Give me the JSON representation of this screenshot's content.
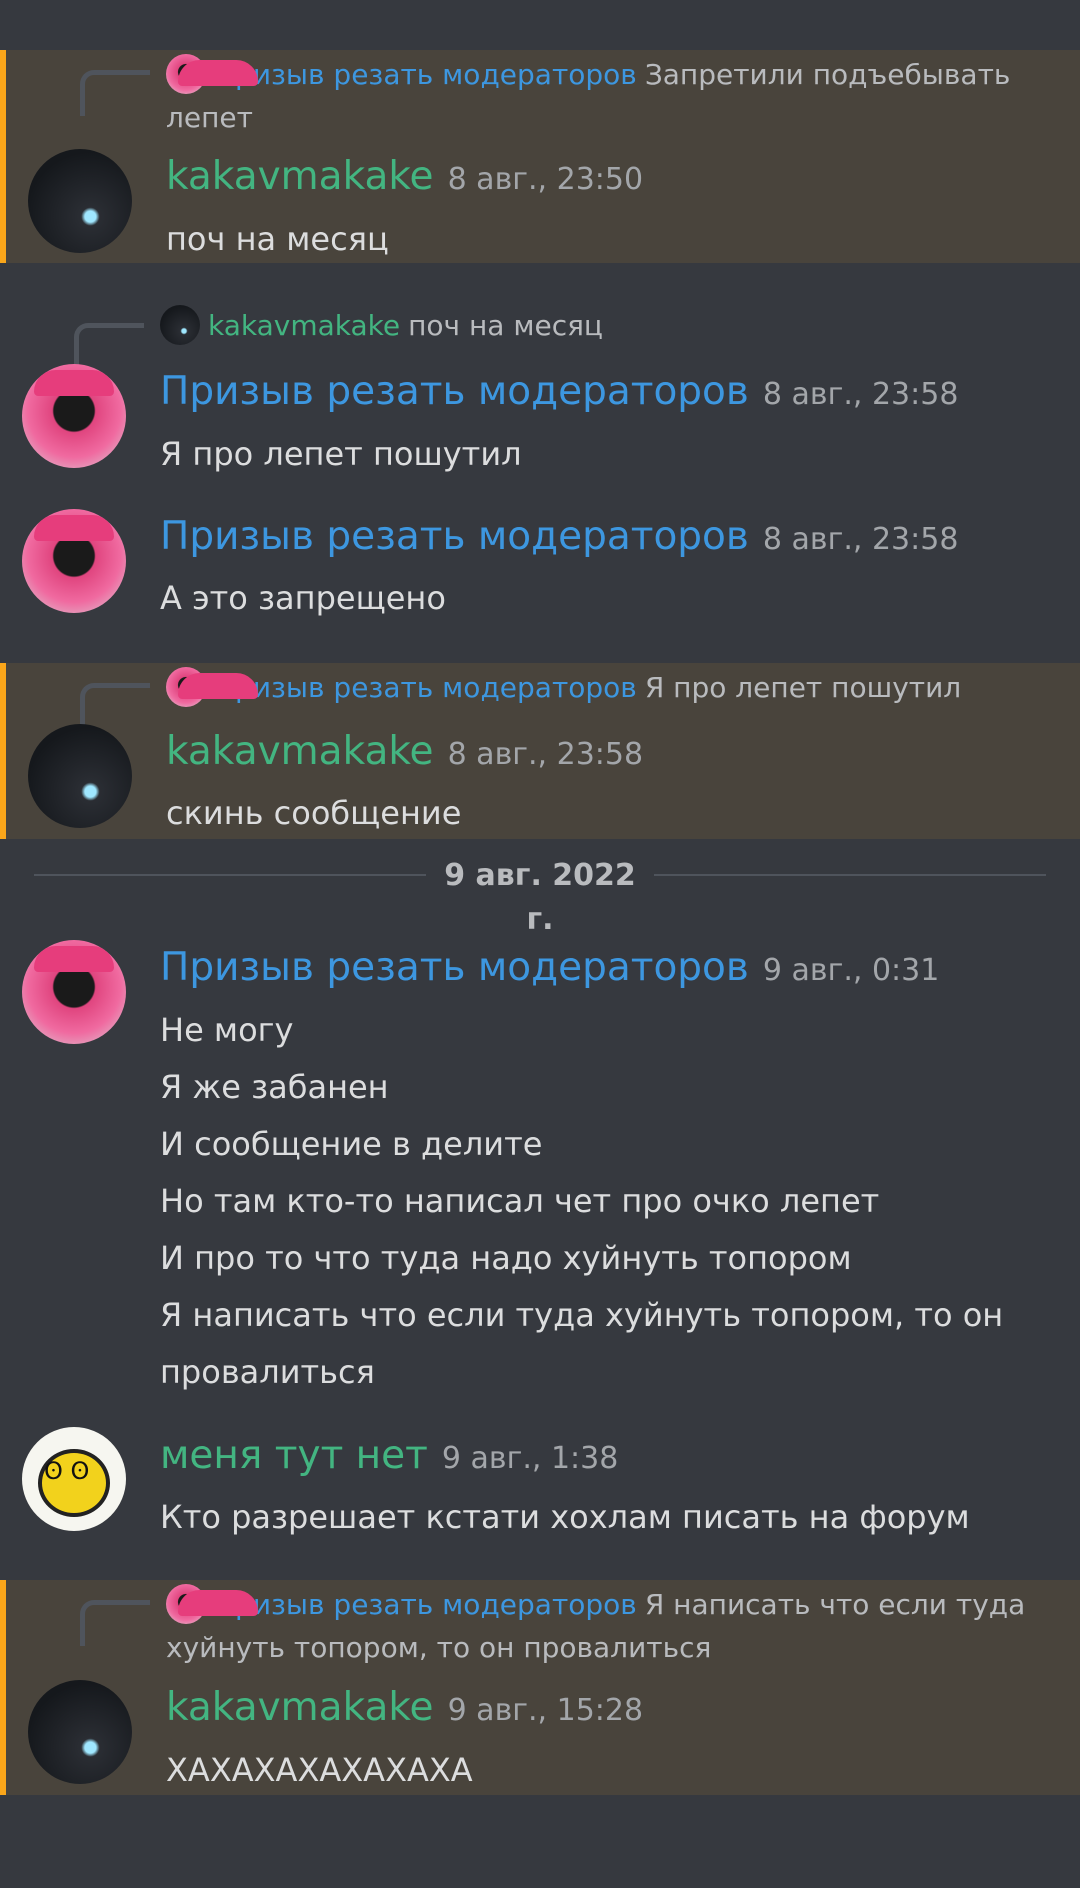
{
  "messages": [
    {
      "reply": {
        "author": "Призыв резать модераторов",
        "preview": "Запретили подъебывать лепет"
      },
      "author": "kakavmakake",
      "timestamp": "8 авг., 23:50",
      "lines": [
        "поч на месяц"
      ]
    },
    {
      "reply": {
        "author": "kakavmakake",
        "preview": "поч на месяц"
      },
      "author": "Призыв резать модераторов",
      "timestamp": "8 авг., 23:58",
      "lines": [
        "Я про лепет пошутил"
      ]
    },
    {
      "author": "Призыв резать модераторов",
      "timestamp": "8 авг., 23:58",
      "lines": [
        "А это запрещено"
      ]
    },
    {
      "reply": {
        "author": "Призыв резать модераторов",
        "preview": "Я про лепет пошутил"
      },
      "author": "kakavmakake",
      "timestamp": "8 авг., 23:58",
      "lines": [
        "скинь сообщение"
      ]
    },
    {
      "author": "Призыв резать модераторов",
      "timestamp": "9 авг., 0:31",
      "lines": [
        "Не могу",
        "Я же забанен",
        "И сообщение в делите",
        "Но там кто-то написал чет про очко лепет",
        "И про то что туда надо хуйнуть топором",
        "Я написать что если туда хуйнуть топором, то он",
        "провалиться"
      ]
    },
    {
      "author": "меня тут нет",
      "timestamp": "9 авг., 1:38",
      "lines": [
        "Кто разрешает кстати хохлам писать на форум"
      ]
    },
    {
      "reply": {
        "author": "Призыв резать модераторов",
        "preview": "Я написать что если туда хуйнуть топором, то он провалиться"
      },
      "author": "kakavmakake",
      "timestamp": "9 авг., 15:28",
      "lines": [
        "ХАХАХАХАХАХАХА"
      ]
    }
  ],
  "date_divider": "9 авг. 2022 г.",
  "colors": {
    "background": "#36393f",
    "mention_bg": "#49443c",
    "mention_bar": "#faa61a",
    "name_blue": "#3d97e0",
    "name_green": "#43b581"
  }
}
